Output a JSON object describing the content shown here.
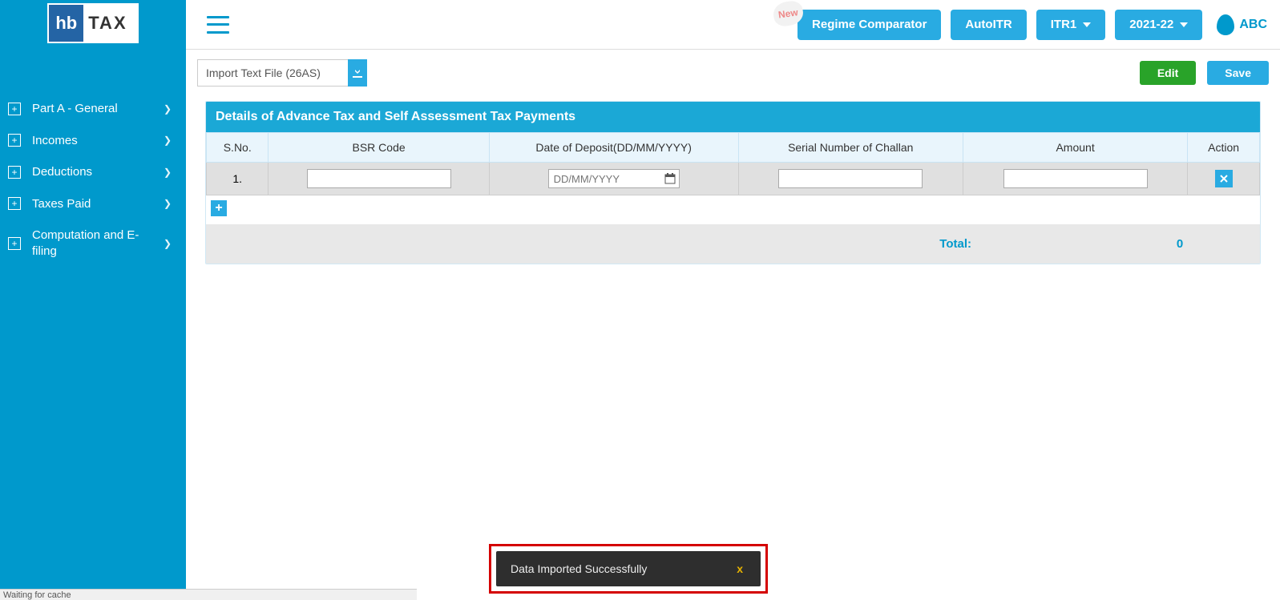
{
  "logo": {
    "hb": "hb",
    "tax": "TAX"
  },
  "sidebar": {
    "items": [
      {
        "label": "Part A - General"
      },
      {
        "label": "Incomes"
      },
      {
        "label": "Deductions"
      },
      {
        "label": "Taxes Paid"
      },
      {
        "label": "Computation and E-filing"
      }
    ]
  },
  "topbar": {
    "new_badge": "New",
    "regime": "Regime Comparator",
    "autoitr": "AutoITR",
    "itr": "ITR1",
    "year": "2021-22",
    "user": "ABC"
  },
  "toolbar": {
    "import_label": "Import Text File (26AS)",
    "edit": "Edit",
    "save": "Save"
  },
  "panel": {
    "title": "Details of Advance Tax and Self Assessment Tax Payments",
    "headers": {
      "sno": "S.No.",
      "bsr": "BSR Code",
      "date": "Date of Deposit(DD/MM/YYYY)",
      "serial": "Serial Number of Challan",
      "amount": "Amount",
      "action": "Action"
    },
    "rows": [
      {
        "sno": "1.",
        "bsr": "",
        "date_placeholder": "DD/MM/YYYY",
        "serial": "",
        "amount": ""
      }
    ],
    "total_label": "Total:",
    "total_value": "0"
  },
  "toast": {
    "message": "Data Imported Successfully",
    "close": "x"
  },
  "status": "Waiting for cache"
}
